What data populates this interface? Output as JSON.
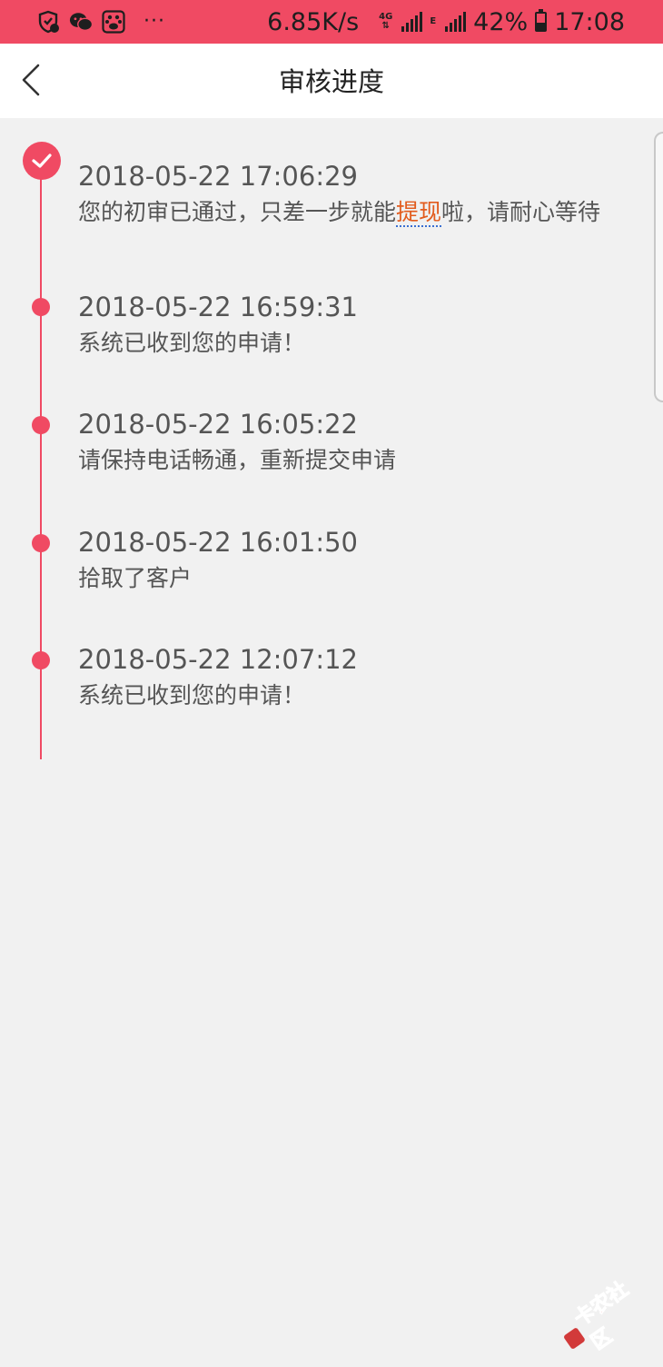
{
  "status_bar": {
    "net_speed": "6.85K/s",
    "net_type": "4G",
    "net_sub": "E",
    "battery_percent": "42%",
    "battery_level": 0.42,
    "time": "17:08",
    "more": "···",
    "icons": [
      "shield-notification-icon",
      "wechat-icon",
      "baidu-paw-icon"
    ]
  },
  "nav": {
    "title": "审核进度",
    "back_icon": "chevron-left-icon"
  },
  "timeline": [
    {
      "time": "2018-05-22 17:06:29",
      "msg_pre": "您的初审已通过，只差一步就能",
      "msg_highlight": "提现",
      "msg_post": "啦，请耐心等待",
      "status": "completed"
    },
    {
      "time": "2018-05-22 16:59:31",
      "msg": "系统已收到您的申请！"
    },
    {
      "time": "2018-05-22 16:05:22",
      "msg": "请保持电话畅通，重新提交申请"
    },
    {
      "time": "2018-05-22 16:01:50",
      "msg": "拾取了客户"
    },
    {
      "time": "2018-05-22 12:07:12",
      "msg": "系统已收到您的申请！"
    }
  ],
  "watermark": {
    "text": "卡农社区"
  },
  "colors": {
    "accent": "#f04a63",
    "highlight": "#e25b1d",
    "background": "#f1f1f1"
  }
}
